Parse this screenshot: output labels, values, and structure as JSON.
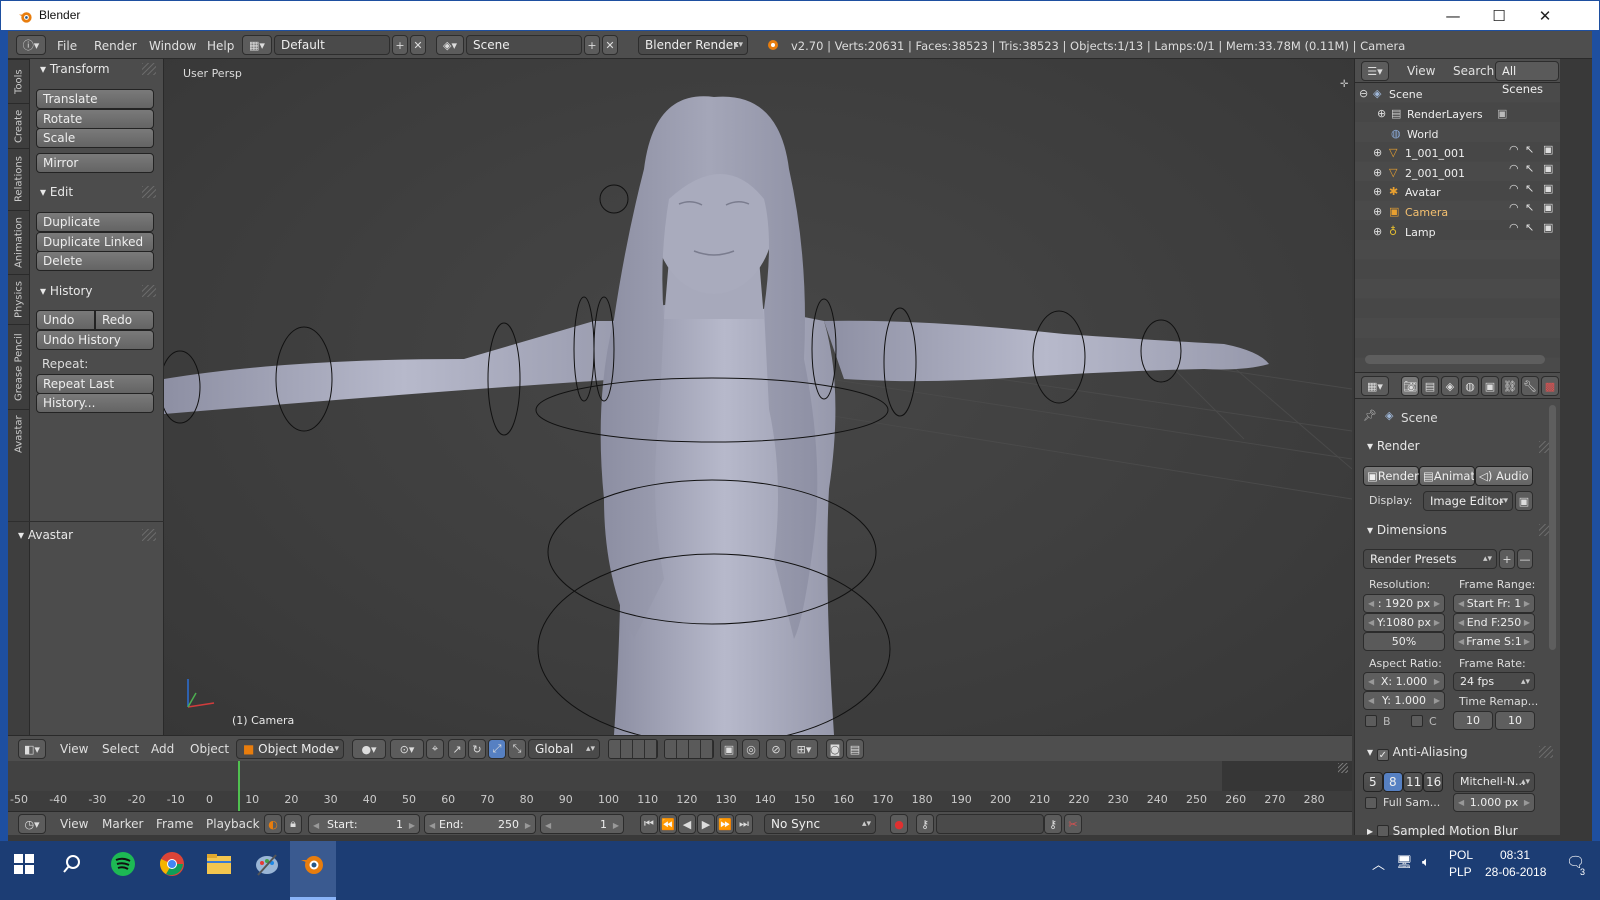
{
  "window": {
    "title": "Blender",
    "minimize": "—",
    "maximize": "☐",
    "close": "✕"
  },
  "info_header": {
    "menus": [
      "File",
      "Render",
      "Window",
      "Help"
    ],
    "layout": "Default",
    "scene": "Scene",
    "engine": "Blender Render",
    "stats": "v2.70 | Verts:20631 | Faces:38523 | Tris:38523 | Objects:1/13 | Lamps:0/1 | Mem:33.78M (0.11M) | Camera"
  },
  "tool_tabs": [
    "Tools",
    "Create",
    "Relations",
    "Animation",
    "Physics",
    "Grease Pencil",
    "Avastar"
  ],
  "tool_shelf": {
    "transform": {
      "title": "Transform",
      "buttons": [
        "Translate",
        "Rotate",
        "Scale",
        "Mirror"
      ]
    },
    "edit": {
      "title": "Edit",
      "buttons": [
        "Duplicate",
        "Duplicate Linked",
        "Delete"
      ]
    },
    "history": {
      "title": "History",
      "undo": "Undo",
      "redo": "Redo",
      "undo_history": "Undo History",
      "repeat_label": "Repeat:",
      "repeat_last": "Repeat Last",
      "history_btn": "History..."
    },
    "avastar": {
      "title": "Avastar"
    }
  },
  "viewport": {
    "view_label": "User Persp",
    "object_label": "(1) Camera"
  },
  "viewport_header": {
    "menus": [
      "View",
      "Select",
      "Add",
      "Object"
    ],
    "mode": "Object Mode",
    "orientation": "Global"
  },
  "timeline": {
    "ticks": [
      "-50",
      "-40",
      "-30",
      "-20",
      "-10",
      "0",
      "10",
      "20",
      "30",
      "40",
      "50",
      "60",
      "70",
      "80",
      "90",
      "100",
      "110",
      "120",
      "130",
      "140",
      "150",
      "160",
      "170",
      "180",
      "190",
      "200",
      "210",
      "220",
      "230",
      "240",
      "250",
      "260",
      "270",
      "280"
    ],
    "menus": [
      "View",
      "Marker",
      "Frame",
      "Playback"
    ],
    "start_label": "Start:",
    "start": "1",
    "end_label": "End:",
    "end": "250",
    "current": "1",
    "sync": "No Sync"
  },
  "outliner": {
    "menus": [
      "View",
      "Search"
    ],
    "filter": "All Scenes",
    "items": [
      {
        "name": "Scene"
      },
      {
        "name": "RenderLayers"
      },
      {
        "name": "World"
      },
      {
        "name": "1_001_001"
      },
      {
        "name": "2_001_001"
      },
      {
        "name": "Avatar"
      },
      {
        "name": "Camera"
      },
      {
        "name": "Lamp"
      }
    ]
  },
  "properties": {
    "context": "Scene",
    "render_panel": "Render",
    "render_btns": [
      "Render",
      "Animati",
      "Audio"
    ],
    "display_label": "Display:",
    "display_value": "Image Editor",
    "dimensions_panel": "Dimensions",
    "render_presets": "Render Presets",
    "resolution_label": "Resolution:",
    "frame_range_label": "Frame Range:",
    "res_x": "1920 px",
    "res_x_prefix": ":",
    "res_y": "Y:1080 px",
    "res_pct": "50%",
    "start_fr": "Start Fr: 1",
    "end_fr": "End F:250",
    "frame_step": "Frame S:1",
    "aspect_label": "Aspect Ratio:",
    "frame_rate_label": "Frame Rate:",
    "aspect_x": "1.000",
    "aspect_x_prefix": "X:",
    "aspect_y": "1.000",
    "aspect_y_prefix": "Y:",
    "fps": "24 fps",
    "time_remap_label": "Time Remap...",
    "border_b": "B",
    "border_c": "C",
    "remap_old": "10",
    "remap_new": "10",
    "aa_panel": "Anti-Aliasing",
    "aa_samples": [
      "5",
      "8",
      "11",
      "16"
    ],
    "aa_filter": "Mitchell-N...",
    "full_sample": "Full Sam...",
    "filter_size": "1.000 px",
    "motion_blur_panel": "Sampled Motion Blur"
  },
  "taskbar": {
    "lang_top": "POL",
    "lang_bottom": "PLP",
    "time": "08:31",
    "date": "28-06-2018",
    "notif": "3"
  }
}
